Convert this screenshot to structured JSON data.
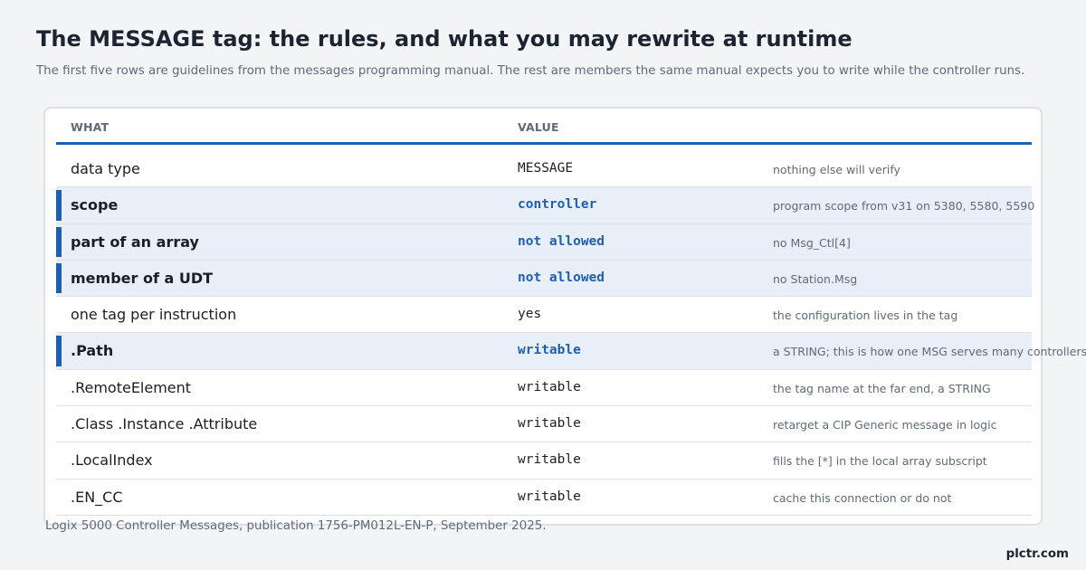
{
  "title": "The MESSAGE tag: the rules, and what you may rewrite at runtime",
  "subtitle": "The first five rows are guidelines from the messages programming manual. The rest are members the same manual expects you to write while the controller runs.",
  "colors": {
    "accent": "#1f5fae",
    "highlight_row": "#e9eff8"
  },
  "table": {
    "headers": [
      "WHAT",
      "VALUE"
    ],
    "rows": [
      {
        "what": "data type",
        "value": "MESSAGE",
        "note": "nothing else will verify",
        "highlight": false
      },
      {
        "what": "scope",
        "value": "controller",
        "note": "program scope from v31 on 5380, 5580, 5590",
        "highlight": true
      },
      {
        "what": "part of an array",
        "value": "not allowed",
        "note": "no Msg_Ctl[4]",
        "highlight": true
      },
      {
        "what": "member of a UDT",
        "value": "not allowed",
        "note": "no Station.Msg",
        "highlight": true
      },
      {
        "what": "one tag per instruction",
        "value": "yes",
        "note": "the configuration lives in the tag",
        "highlight": false
      },
      {
        "what": ".Path",
        "value": "writable",
        "note": "a STRING; this is how one MSG serves many controllers",
        "highlight": true
      },
      {
        "what": ".RemoteElement",
        "value": "writable",
        "note": "the tag name at the far end, a STRING",
        "highlight": false
      },
      {
        "what": ".Class .Instance .Attribute",
        "value": "writable",
        "note": "retarget a CIP Generic message in logic",
        "highlight": false
      },
      {
        "what": ".LocalIndex",
        "value": "writable",
        "note": "fills the [*] in the local array subscript",
        "highlight": false
      },
      {
        "what": ".EN_CC",
        "value": "writable",
        "note": "cache this connection or do not",
        "highlight": false
      }
    ]
  },
  "footnote": "Logix 5000 Controller Messages, publication 1756-PM012L-EN-P, September 2025.",
  "brand": "plctr.com"
}
